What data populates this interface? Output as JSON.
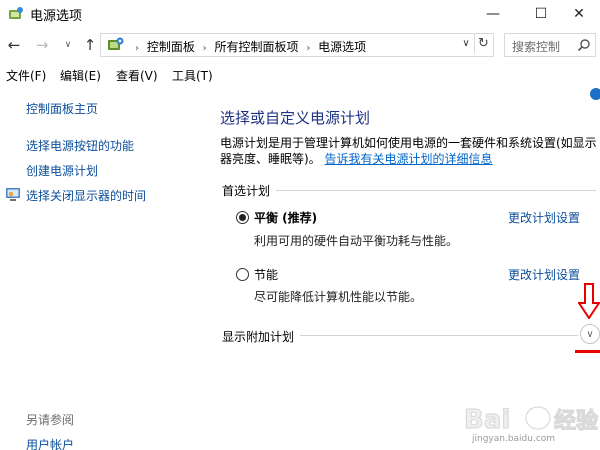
{
  "window": {
    "title": "电源选项",
    "minimize_glyph": "—",
    "maximize_glyph": "☐",
    "close_glyph": "✕"
  },
  "nav": {
    "back_glyph": "←",
    "forward_glyph": "→",
    "dropdown_glyph": "∨",
    "up_glyph": "↑",
    "breadcrumb": [
      "控制面板",
      "所有控制面板项",
      "电源选项"
    ],
    "separator": "›",
    "address_dropdown_glyph": "∨",
    "refresh_glyph": "↻",
    "search_placeholder": "搜索控制"
  },
  "menu": {
    "file": "文件(F)",
    "edit": "编辑(E)",
    "view": "查看(V)",
    "tools": "工具(T)"
  },
  "sidebar": {
    "home": "控制面板主页",
    "power_buttons": "选择电源按钮的功能",
    "create_plan": "创建电源计划",
    "display_off": "选择关闭显示器的时间",
    "see_also": "另请参阅",
    "user_accounts": "用户帐户"
  },
  "main": {
    "title": "选择或自定义电源计划",
    "description": "电源计划是用于管理计算机如何使用电源的一套硬件和系统设置(如显示器亮度、睡眠等)。",
    "description_link": "告诉我有关电源计划的详细信息",
    "preferred_plans": "首选计划",
    "plans": [
      {
        "name": "平衡 (推荐)",
        "description": "利用可用的硬件自动平衡功耗与性能。",
        "change_link": "更改计划设置",
        "selected": true
      },
      {
        "name": "节能",
        "description": "尽可能降低计算机性能以节能。",
        "change_link": "更改计划设置",
        "selected": false
      }
    ],
    "show_additional": "显示附加计划",
    "expand_glyph": "∨"
  },
  "annotation": {
    "color": "#e60000"
  },
  "watermark": {
    "text": "jingyan.baidu.com",
    "color": "#9b9b9b"
  },
  "colors": {
    "link": "#0a4e9b",
    "title": "#1e3287",
    "accent": "#1c6fc8"
  }
}
